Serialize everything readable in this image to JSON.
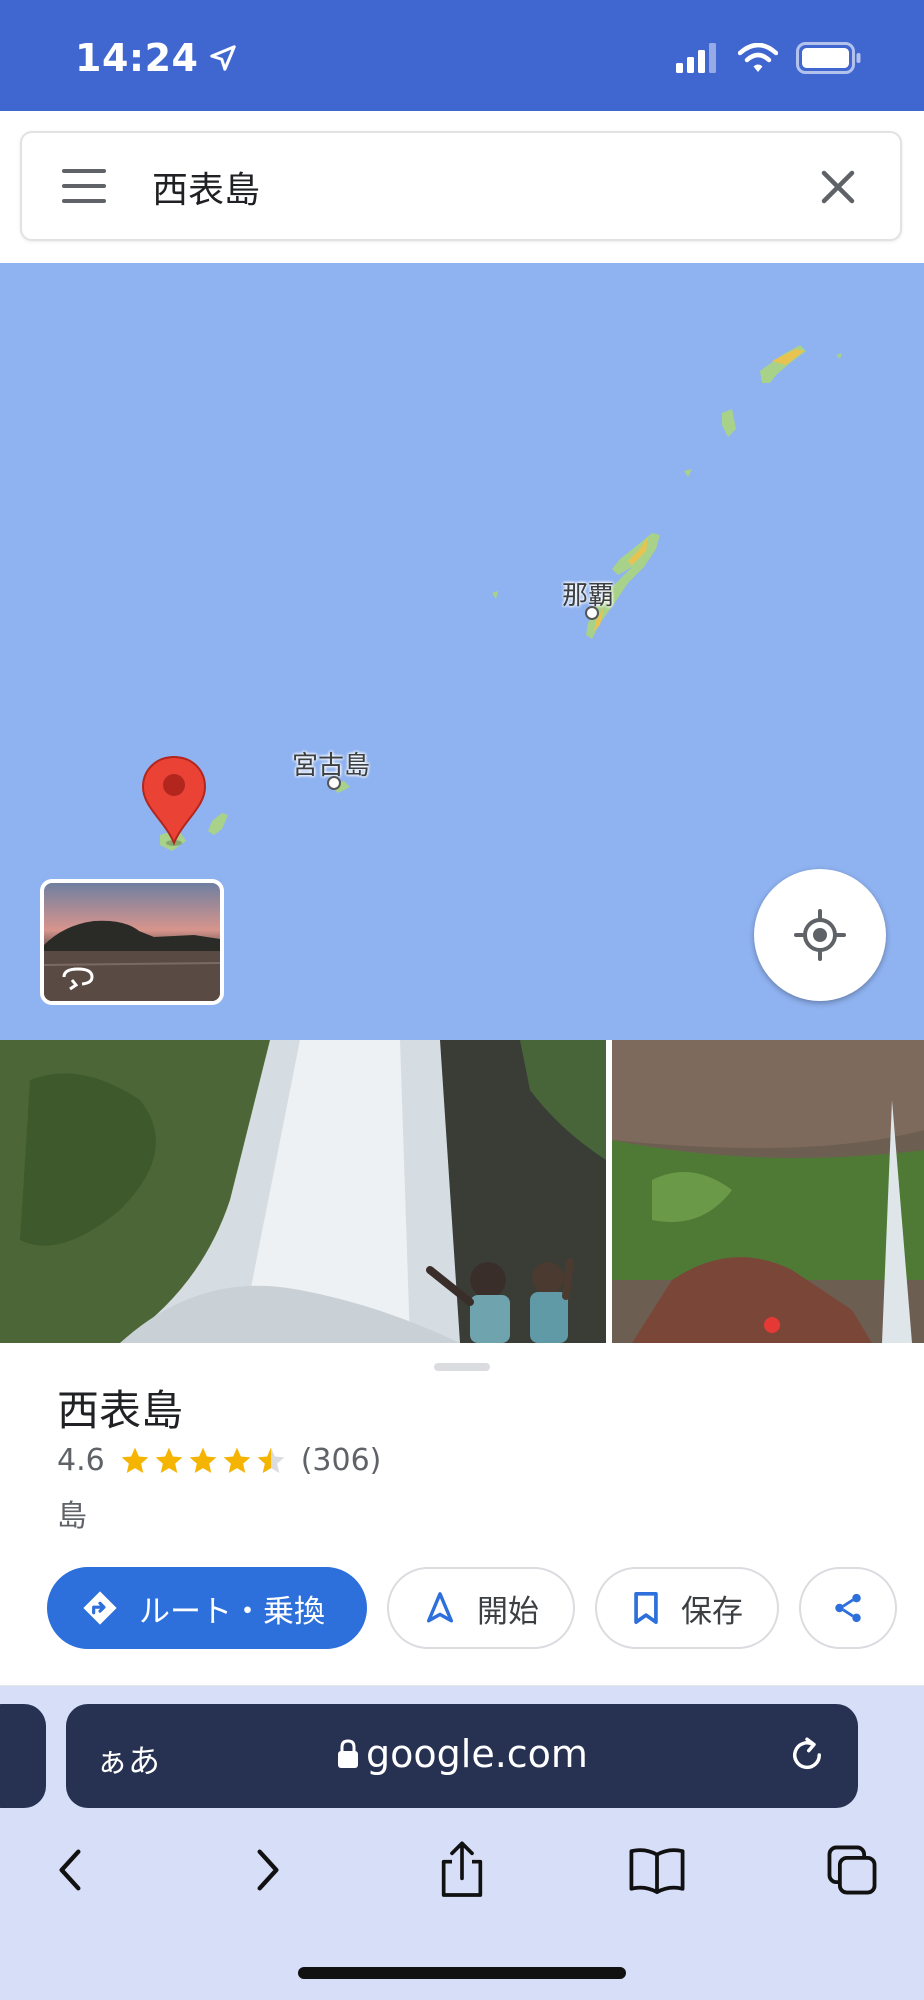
{
  "status_bar": {
    "time": "14:24"
  },
  "search": {
    "query": "西表島"
  },
  "map": {
    "labels": {
      "naha": "那覇",
      "miyako": "宮古島"
    }
  },
  "place": {
    "name": "西表島",
    "rating": "4.6",
    "rating_value": 4.6,
    "review_count": "(306)",
    "category": "島"
  },
  "actions": {
    "directions": "ルート・乗換",
    "start": "開始",
    "save": "保存"
  },
  "browser": {
    "aa": "ぁあ",
    "domain": "google.com"
  },
  "colors": {
    "status_bar": "#4066cf",
    "map_water": "#8fb2f0",
    "primary_button": "#2d6fdb",
    "star": "#f4b400",
    "browser_bar": "#273152"
  }
}
